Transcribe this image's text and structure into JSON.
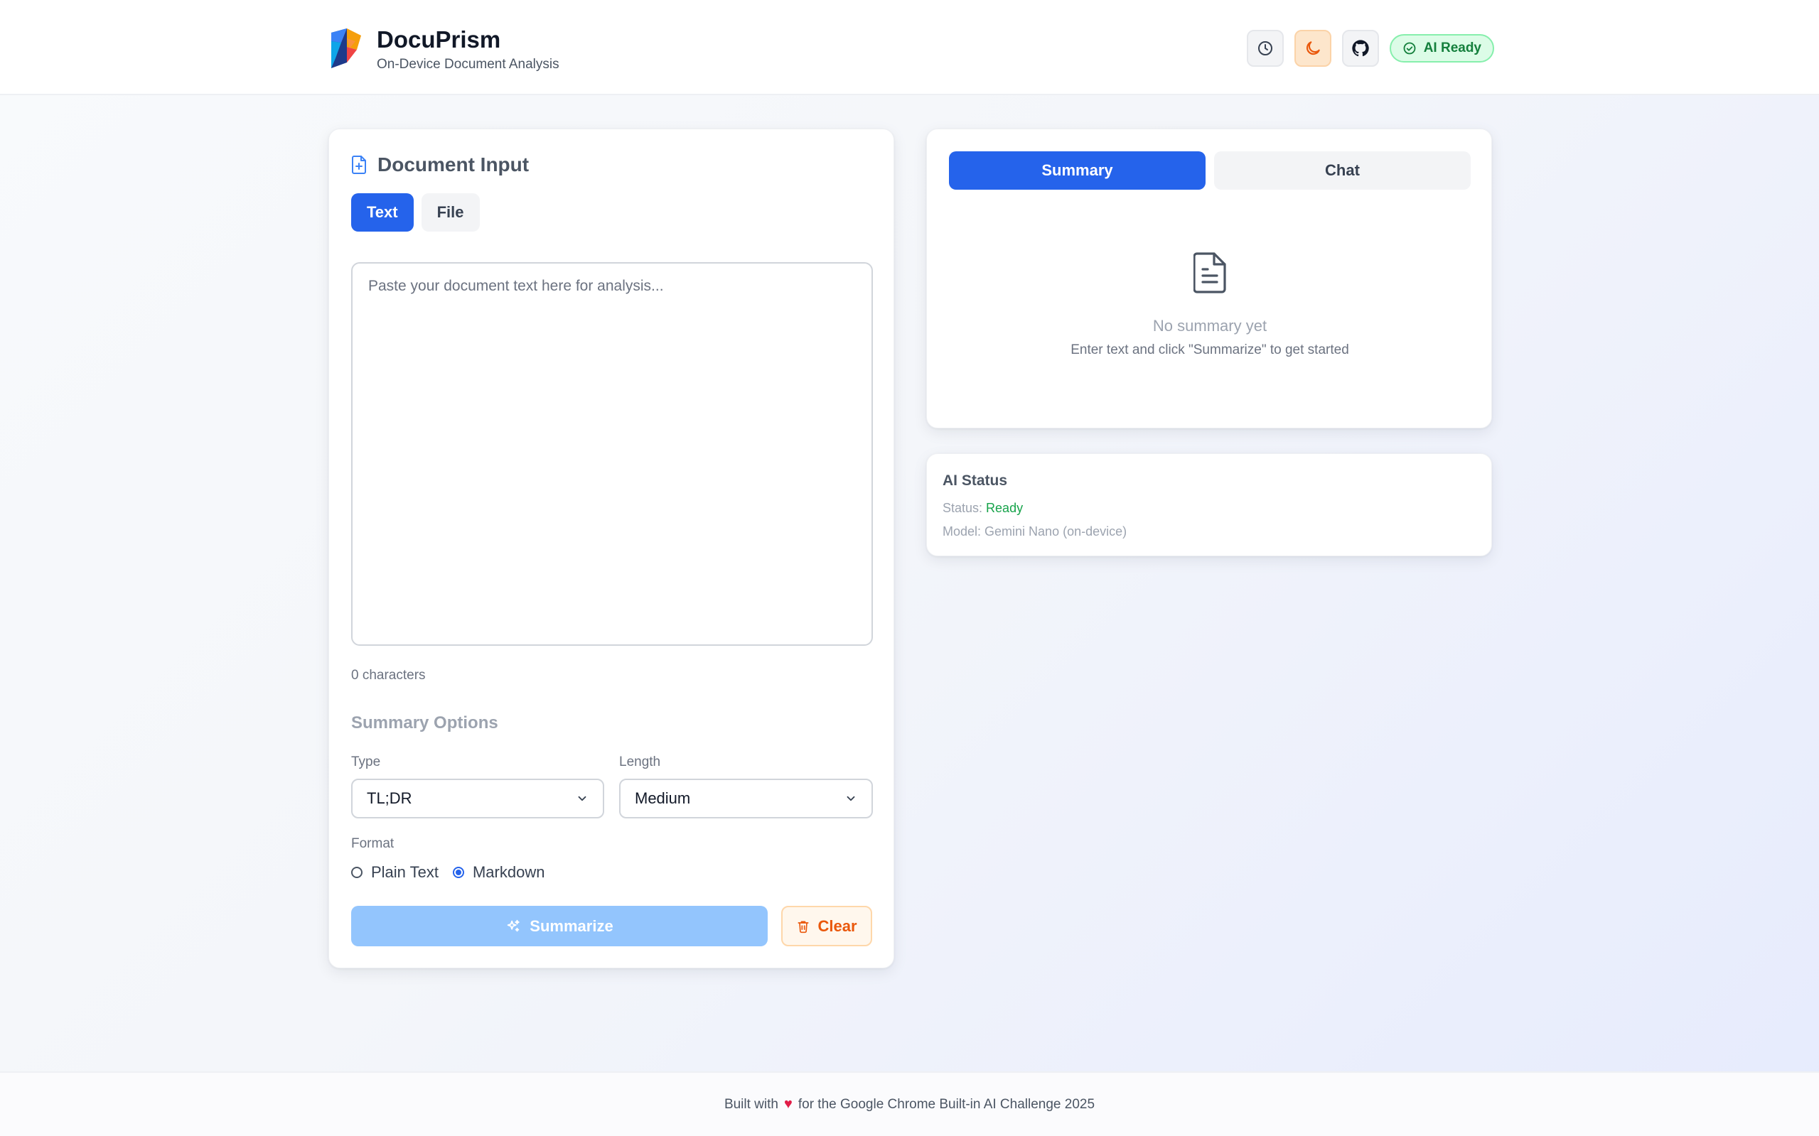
{
  "header": {
    "app_name": "DocuPrism",
    "tagline": "On-Device Document Analysis",
    "ai_badge": "AI Ready",
    "icons": [
      "history-icon",
      "moon-icon",
      "github-icon",
      "check-circle-icon"
    ]
  },
  "input_card": {
    "title": "Document Input",
    "tabs": [
      {
        "label": "Text",
        "active": true
      },
      {
        "label": "File",
        "active": false
      }
    ],
    "textarea": {
      "value": "",
      "placeholder": "Paste your document text here for analysis..."
    },
    "char_count": "0 characters",
    "options_title": "Summary Options",
    "type": {
      "label": "Type",
      "selected": "TL;DR"
    },
    "length": {
      "label": "Length",
      "selected": "Medium"
    },
    "format": {
      "label": "Format",
      "options": [
        {
          "label": "Plain Text",
          "checked": false
        },
        {
          "label": "Markdown",
          "checked": true
        }
      ]
    },
    "summarize_label": "Summarize",
    "clear_label": "Clear"
  },
  "summary_card": {
    "tabs": [
      {
        "label": "Summary",
        "active": true
      },
      {
        "label": "Chat",
        "active": false
      }
    ],
    "empty_title": "No summary yet",
    "empty_subtitle": "Enter text and click \"Summarize\" to get started"
  },
  "status_card": {
    "title": "AI Status",
    "status_prefix": "Status:",
    "status_value": "Ready",
    "model_line": "Model: Gemini Nano (on-device)"
  },
  "footer": {
    "prefix": "Built with",
    "suffix": "for the Google Chrome Built-in AI Challenge 2025"
  },
  "colors": {
    "primary": "#2563eb",
    "success": "#16a34a",
    "warning": "#ea580c"
  }
}
